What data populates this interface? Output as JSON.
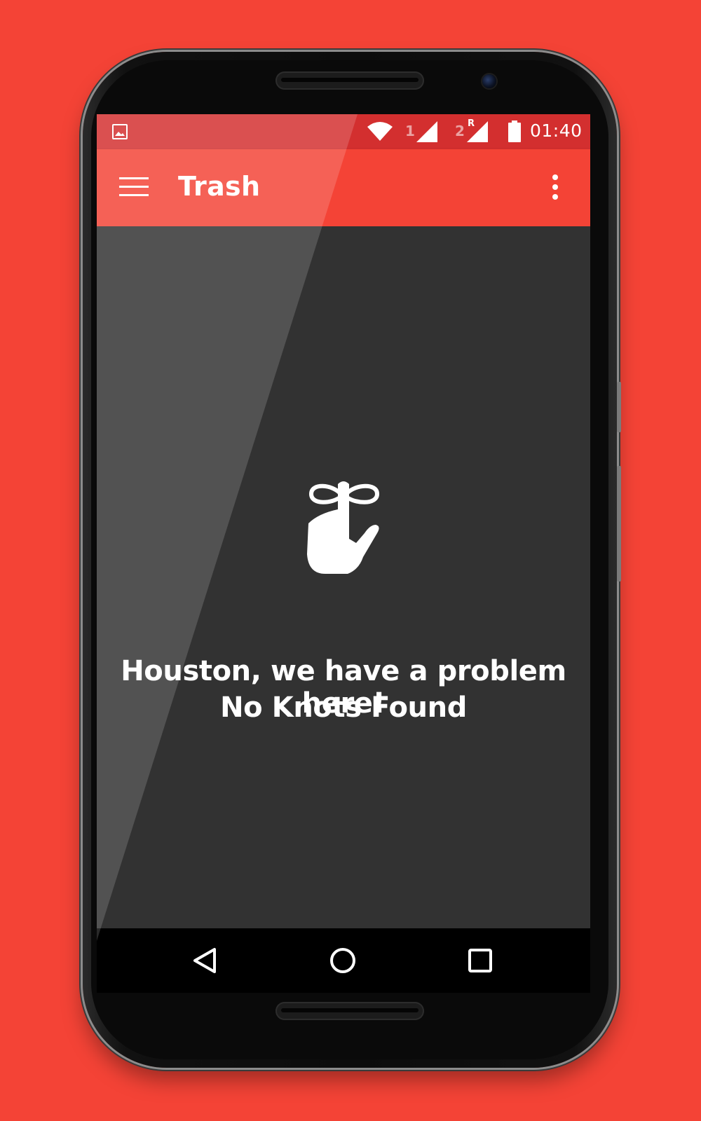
{
  "status_bar": {
    "time": "01:40",
    "sim1_label": "1",
    "sim2_label": "2",
    "roaming_label": "R",
    "icons": [
      "gallery-icon",
      "wifi-icon",
      "signal-icon",
      "signal-icon",
      "battery-icon"
    ]
  },
  "toolbar": {
    "title": "Trash",
    "menu_icon": "hamburger-menu-icon",
    "more_icon": "more-vertical-icon"
  },
  "empty_state": {
    "icon": "finger-with-bow-icon",
    "line1": "Houston, we have a problem here!",
    "line2": "No Knots Found"
  },
  "nav_bar": {
    "buttons": [
      "back-icon",
      "home-icon",
      "recents-icon"
    ]
  },
  "colors": {
    "background": "#f44336",
    "status_bar": "#d32f2f",
    "toolbar": "#f44336",
    "content": "#323232",
    "nav_bar": "#000000"
  }
}
